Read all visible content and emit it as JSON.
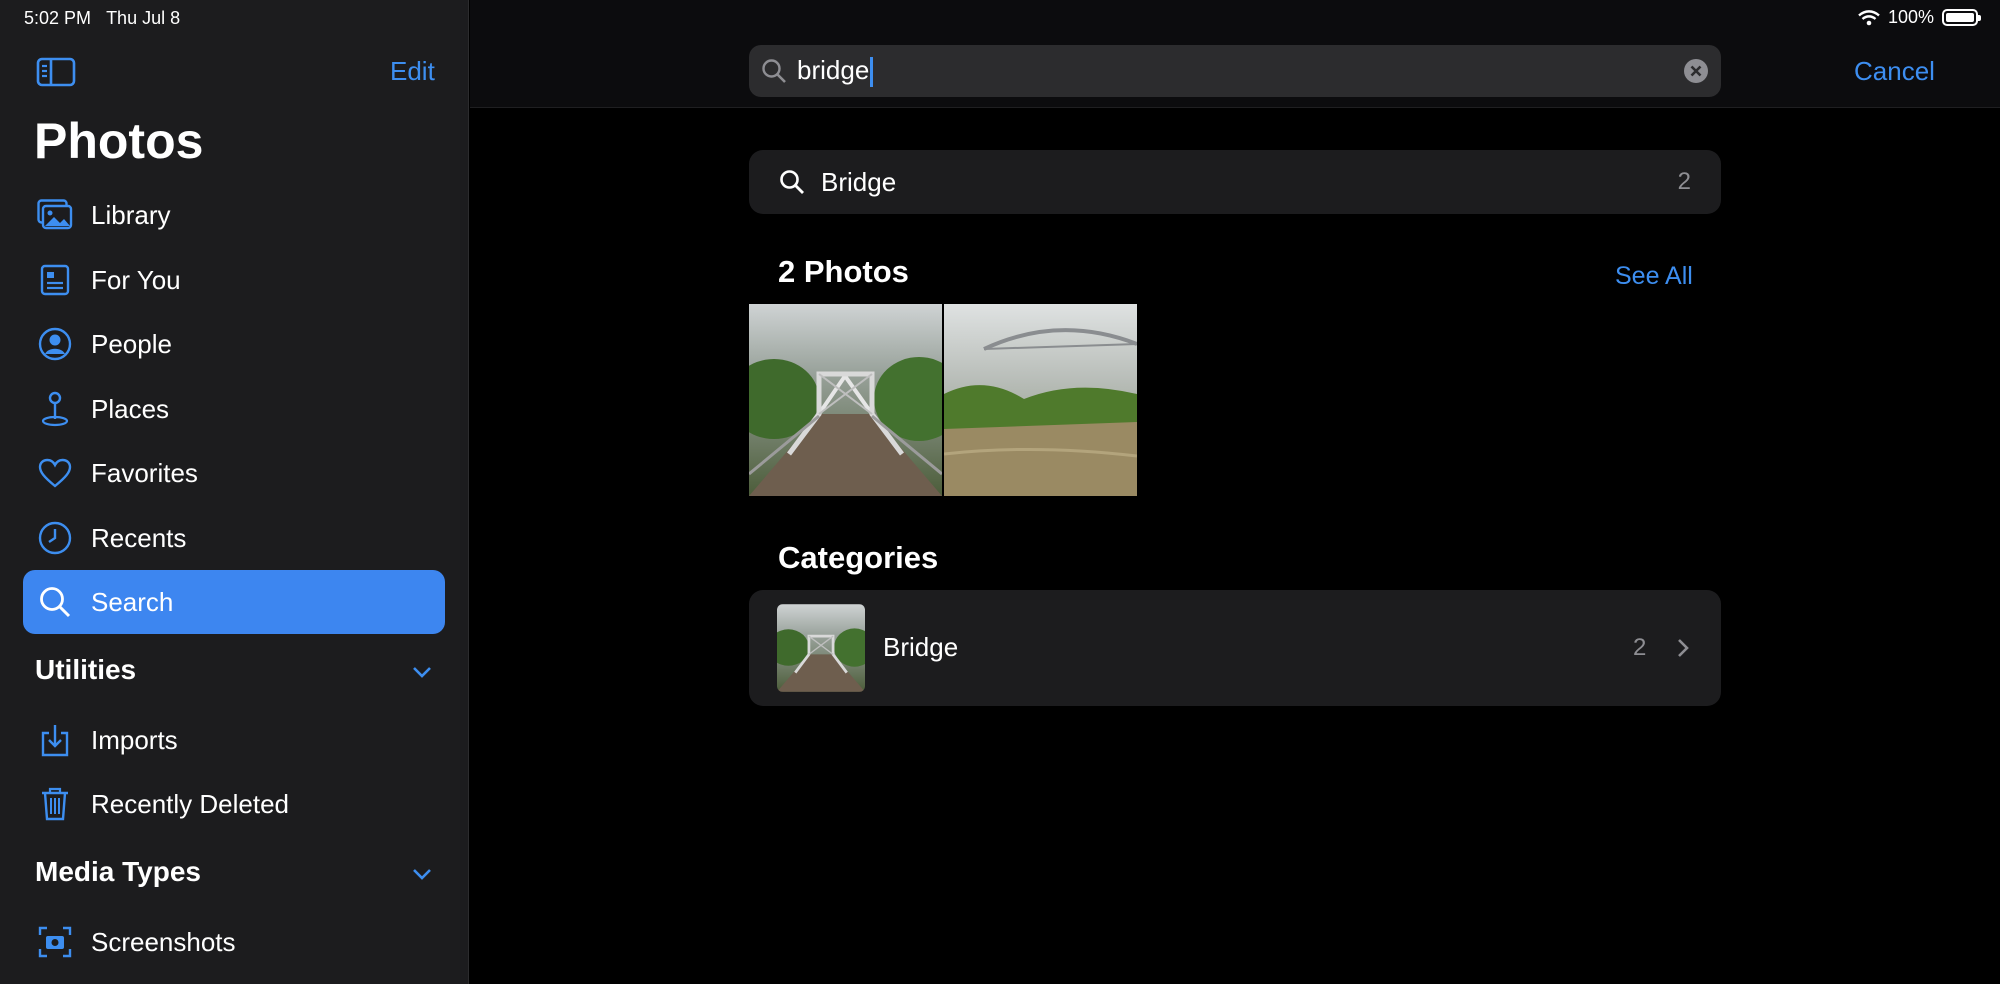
{
  "status": {
    "time": "5:02 PM",
    "date": "Thu Jul 8",
    "battery": "100%"
  },
  "sidebar": {
    "edit_label": "Edit",
    "title": "Photos",
    "items": [
      {
        "label": "Library",
        "icon": "photo-library-icon"
      },
      {
        "label": "For You",
        "icon": "for-you-icon"
      },
      {
        "label": "People",
        "icon": "person-circle-icon"
      },
      {
        "label": "Places",
        "icon": "map-pin-icon"
      },
      {
        "label": "Favorites",
        "icon": "heart-icon"
      },
      {
        "label": "Recents",
        "icon": "clock-icon"
      },
      {
        "label": "Search",
        "icon": "search-icon",
        "active": true
      }
    ],
    "utilities": {
      "header": "Utilities",
      "items": [
        {
          "label": "Imports",
          "icon": "import-icon"
        },
        {
          "label": "Recently Deleted",
          "icon": "trash-icon"
        }
      ]
    },
    "media_types": {
      "header": "Media Types",
      "items": [
        {
          "label": "Screenshots",
          "icon": "screenshot-icon"
        }
      ]
    }
  },
  "search": {
    "value": "bridge",
    "cancel_label": "Cancel"
  },
  "suggestion": {
    "label": "Bridge",
    "count": "2"
  },
  "photos": {
    "header": "2 Photos",
    "see_all_label": "See All"
  },
  "categories": {
    "header": "Categories",
    "items": [
      {
        "label": "Bridge",
        "count": "2"
      }
    ]
  },
  "colors": {
    "accent": "#3d8ef0",
    "active_bg": "#3d86f0",
    "panel": "#1c1c1e",
    "background": "#000000"
  }
}
